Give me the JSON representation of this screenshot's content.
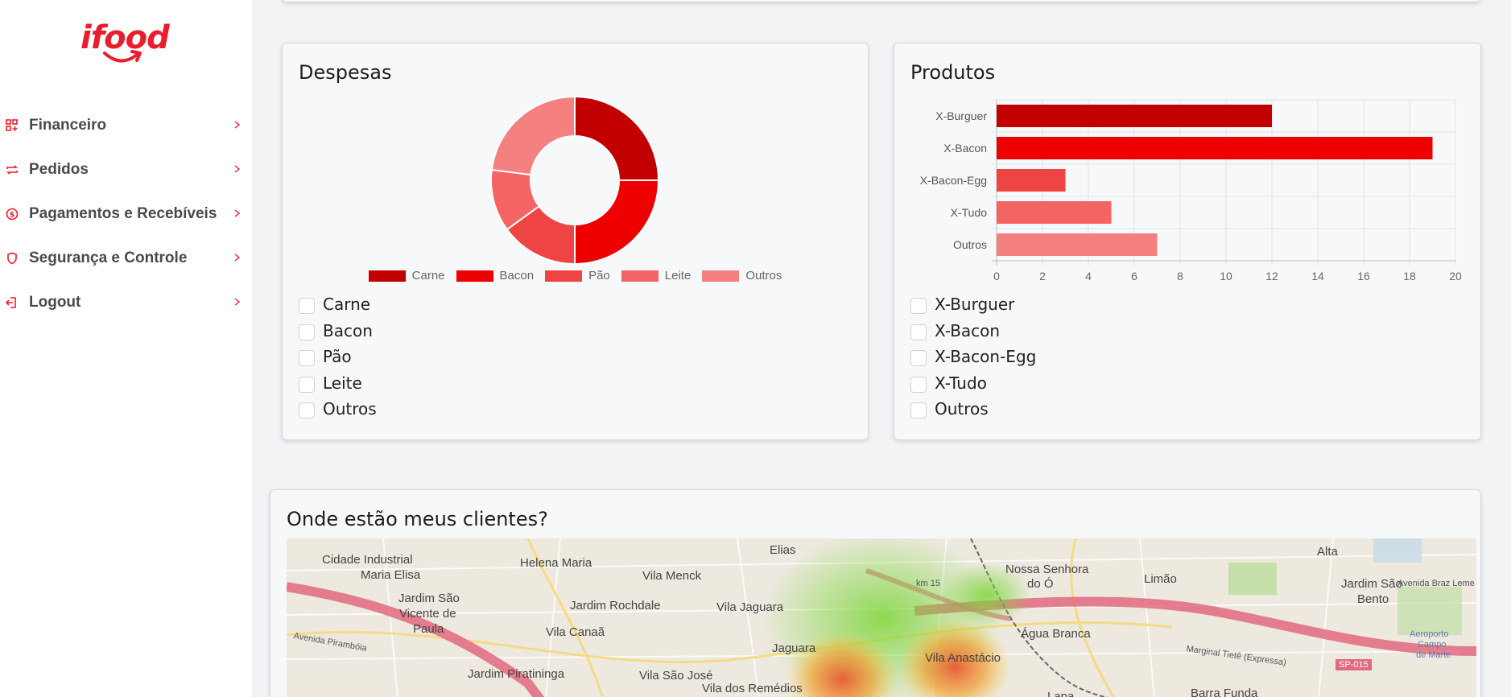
{
  "brand": {
    "logo_text": "ifood",
    "color": "#ea1d2c"
  },
  "sidebar": {
    "items": [
      {
        "label": "Financeiro",
        "icon": "dashboard-add-icon"
      },
      {
        "label": "Pedidos",
        "icon": "repeat-icon"
      },
      {
        "label": "Pagamentos e Recebíveis",
        "icon": "dollar-circle-icon"
      },
      {
        "label": "Segurança e Controle",
        "icon": "shield-icon"
      },
      {
        "label": "Logout",
        "icon": "logout-icon"
      }
    ]
  },
  "despesas": {
    "title": "Despesas",
    "checkboxes": [
      "Carne",
      "Bacon",
      "Pão",
      "Leite",
      "Outros"
    ]
  },
  "produtos": {
    "title": "Produtos",
    "checkboxes": [
      "X-Burguer",
      "X-Bacon",
      "X-Bacon-Egg",
      "X-Tudo",
      "Outros"
    ]
  },
  "chart_data": [
    {
      "type": "pie",
      "title": "",
      "donut": true,
      "categories": [
        "Carne",
        "Bacon",
        "Pão",
        "Leite",
        "Outros"
      ],
      "values": [
        25,
        25,
        15,
        12,
        23
      ],
      "colors": [
        "#c20000",
        "#ee0000",
        "#ee4444",
        "#f46464",
        "#f48080"
      ],
      "legend": "bottom"
    },
    {
      "type": "bar",
      "orientation": "horizontal",
      "title": "",
      "categories": [
        "X-Burguer",
        "X-Bacon",
        "X-Bacon-Egg",
        "X-Tudo",
        "Outros"
      ],
      "values": [
        12,
        19,
        3,
        5,
        7
      ],
      "colors": [
        "#c20000",
        "#ee0000",
        "#ee4444",
        "#f46464",
        "#f48080"
      ],
      "xlim": [
        0,
        20
      ],
      "xticks": [
        0,
        2,
        4,
        6,
        8,
        10,
        12,
        14,
        16,
        18,
        20
      ],
      "grid": true
    }
  ],
  "map": {
    "title": "Onde estão meus clientes?",
    "labels": [
      "Cidade Industrial",
      "Maria Elisa",
      "Helena Maria",
      "Elias",
      "Vila Menck",
      "Nossa Senhora",
      "do Ó",
      "Limão",
      "Alta",
      "Jardim São",
      "Bento",
      "Jardim São",
      "Vicente de",
      "Paula",
      "Jardim Rochdale",
      "Vila Jaguara",
      "Vila Canaã",
      "Jaguara",
      "Água Branca",
      "Vila Anastácio",
      "Jardim Piratininga",
      "Vila São José",
      "Vila dos Remédios",
      "Lapa",
      "Barra Funda",
      "Aeroporto",
      "Campo",
      "de Marte",
      "SP-015",
      "Marginal Tietê (Expressa)",
      "Avenida Pirambóia",
      "Avenida Braz Leme",
      "km 15"
    ]
  }
}
